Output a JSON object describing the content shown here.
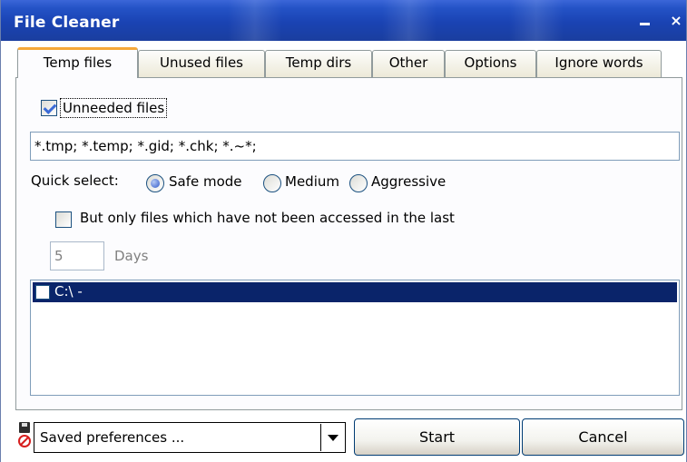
{
  "window": {
    "title": "File Cleaner",
    "minimize_glyph": "–",
    "close_glyph": "×"
  },
  "tabs": [
    {
      "label": "Temp files",
      "active": true
    },
    {
      "label": "Unused files",
      "active": false
    },
    {
      "label": "Temp dirs",
      "active": false
    },
    {
      "label": "Other",
      "active": false
    },
    {
      "label": "Options",
      "active": false
    },
    {
      "label": "Ignore words",
      "active": false
    }
  ],
  "temp_files": {
    "unneeded_checked": true,
    "unneeded_label": "Unneeded files",
    "patterns_value": "*.tmp; *.temp; *.gid; *.chk; *.~*;",
    "quick_select_label": "Quick select:",
    "quick_select_options": [
      "Safe mode",
      "Medium",
      "Aggressive"
    ],
    "quick_select_selected": "Safe mode",
    "accessed_checked": false,
    "accessed_label": "But only files which have not been accessed in the last",
    "days_value": "5",
    "days_label": "Days",
    "drives": [
      {
        "label": "C:\\  -",
        "checked": false,
        "selected": true
      }
    ]
  },
  "bottom": {
    "prefs_icon": "disk-no-icon",
    "saved_preferences": "Saved preferences ...",
    "start_label": "Start",
    "cancel_label": "Cancel"
  },
  "colors": {
    "titlebar": "#1a43b3",
    "tab_active_accent": "#f5a83a",
    "selection": "#0a246a"
  }
}
